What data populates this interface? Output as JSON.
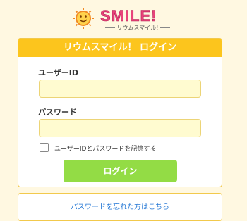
{
  "logo": {
    "text": "SMILE!",
    "sub": "リウムスマイル!",
    "icon": "smiley-sun-icon"
  },
  "form": {
    "title": "リウムスマイル！ ログイン",
    "userid_label": "ユーザーID",
    "userid_value": "",
    "password_label": "パスワード",
    "password_value": "",
    "remember_label": "ユーザーIDとパスワードを記憶する",
    "remember_checked": false,
    "login_button": "ログイン"
  },
  "forgot": {
    "link": "パスワードを忘れた方はこちら"
  },
  "colors": {
    "background": "#fff8e1",
    "header": "#fcc51d",
    "button": "#93dc45",
    "input_bg": "#fffbd0",
    "link": "#2a7bd6"
  }
}
